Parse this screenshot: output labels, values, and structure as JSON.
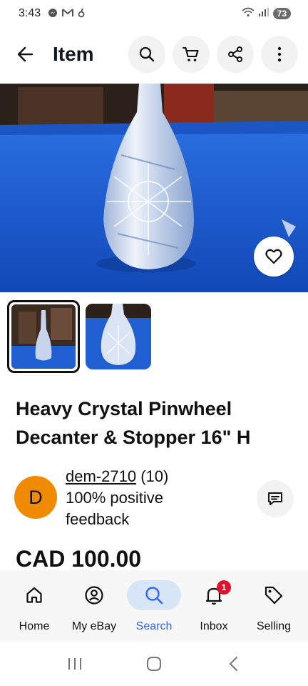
{
  "status_bar": {
    "time": "3:43",
    "battery": "73"
  },
  "header": {
    "title": "Item"
  },
  "listing": {
    "title": "Heavy Crystal Pinwheel Decanter & Stopper 16\" H",
    "price": "CAD 100.00"
  },
  "seller": {
    "initial": "D",
    "name": "dem-2710",
    "rating_count": "(10)",
    "feedback": "100% positive feedback"
  },
  "bottom_nav": {
    "items": [
      {
        "label": "Home",
        "icon": "home-icon"
      },
      {
        "label": "My eBay",
        "icon": "account-icon"
      },
      {
        "label": "Search",
        "icon": "search-icon"
      },
      {
        "label": "Inbox",
        "icon": "bell-icon"
      },
      {
        "label": "Selling",
        "icon": "tag-icon"
      }
    ],
    "active": "Search",
    "inbox_badge": "1"
  },
  "colors": {
    "accent": "#3665f3",
    "active_pill": "#d6e6f7",
    "avatar": "#f08a00",
    "badge": "#e0102f",
    "image_backdrop": "#1f5fd0"
  }
}
